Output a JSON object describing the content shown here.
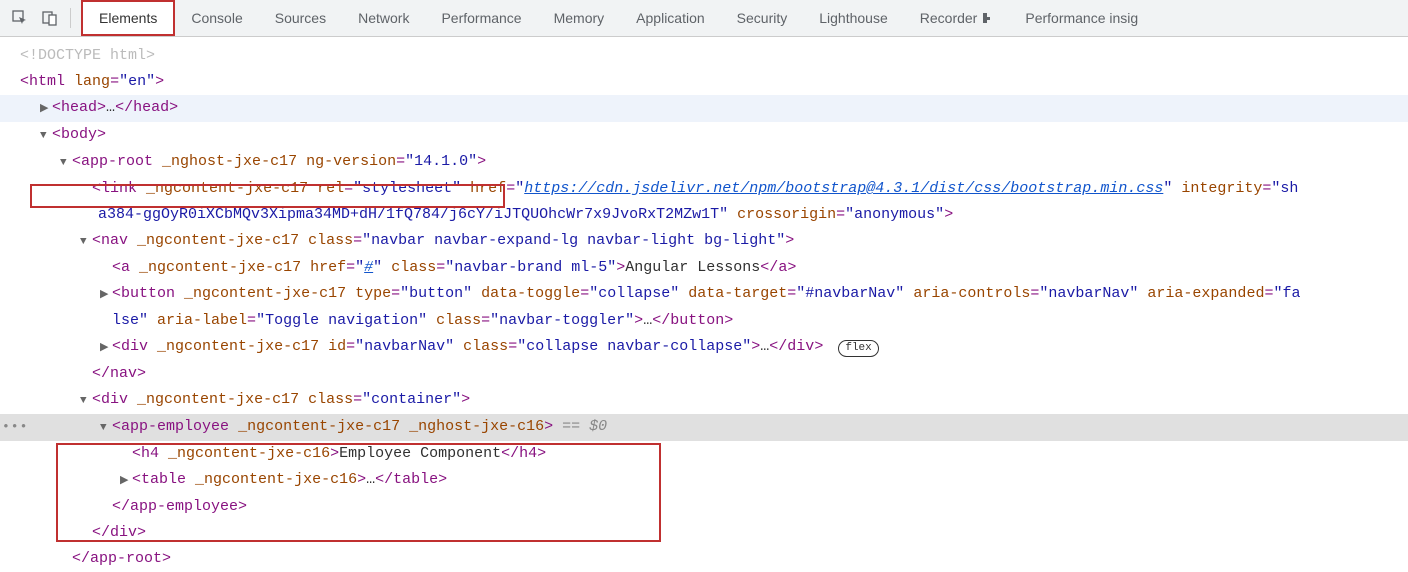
{
  "toolbar": {
    "tabs": [
      "Elements",
      "Console",
      "Sources",
      "Network",
      "Performance",
      "Memory",
      "Application",
      "Security",
      "Lighthouse",
      "Recorder",
      "Performance insig"
    ]
  },
  "dom": {
    "doctype": "<!DOCTYPE html>",
    "html_open_1": "<",
    "html_open_tag": "html",
    "html_lang_attr": "lang",
    "html_lang_val": "\"en\"",
    "html_open_2": ">",
    "head_open": "<",
    "head_tag": "head",
    "head_close": "</",
    "body_open": "<",
    "body_tag": "body",
    "approot_tag": "app-root",
    "approot_attr1": "_nghost-jxe-c17",
    "approot_attr2": "ng-version",
    "approot_attr2_val": "\"14.1.0\"",
    "link_tag": "link",
    "link_attrs": "_ngcontent-jxe-c17",
    "link_rel": "rel",
    "link_rel_v": "\"stylesheet\"",
    "link_href": "href",
    "link_href_v": "https://cdn.jsdelivr.net/npm/bootstrap@4.3.1/dist/css/bootstrap.min.css",
    "link_integ": "integrity",
    "link_integ_v": "\"sh",
    "link_integ_wrap": "a384-ggOyR0iXCbMQv3Xipma34MD+dH/1fQ784/j6cY/iJTQUOhcWr7x9JvoRxT2MZw1T\"",
    "link_cross": "crossorigin",
    "link_cross_v": "\"anonymous\"",
    "nav_tag": "nav",
    "nav_attr1": "_ngcontent-jxe-c17",
    "nav_class": "class",
    "nav_class_v": "\"navbar navbar-expand-lg navbar-light bg-light\"",
    "a_tag": "a",
    "a_attr1": "_ngcontent-jxe-c17",
    "a_href": "href",
    "a_href_v": "#",
    "a_class_v": "\"navbar-brand ml-5\"",
    "a_text": "Angular Lessons",
    "btn_tag": "button",
    "btn_attr1": "_ngcontent-jxe-c17",
    "btn_type": "type",
    "btn_type_v": "\"button\"",
    "btn_dt": "data-toggle",
    "btn_dt_v": "\"collapse\"",
    "btn_dtar": "data-target",
    "btn_dtar_v": "\"#navbarNav\"",
    "btn_ac": "aria-controls",
    "btn_ac_v": "\"navbarNav\"",
    "btn_ae": "aria-expanded",
    "btn_ae_v": "\"fa",
    "btn_wrap": "lse\"",
    "btn_al": "aria-label",
    "btn_al_v": "\"Toggle navigation\"",
    "btn_class_v": "\"navbar-toggler\"",
    "div_tag": "div",
    "div_attr1": "_ngcontent-jxe-c17",
    "div_id": "id",
    "div_id_v": "\"navbarNav\"",
    "div_class_v": "\"collapse navbar-collapse\"",
    "flex_label": "flex",
    "cont_class_v": "\"container\"",
    "emp_tag": "app-employee",
    "emp_attr1": "_ngcontent-jxe-c17",
    "emp_attr2": "_nghost-jxe-c16",
    "eqd": "== $0",
    "h4_tag": "h4",
    "h4_attr": "_ngcontent-jxe-c16",
    "h4_text": "Employee Component",
    "table_tag": "table",
    "table_attr": "_ngcontent-jxe-c16",
    "dots": "…",
    "threedots": "•••"
  }
}
